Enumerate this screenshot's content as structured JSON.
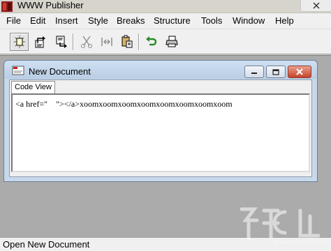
{
  "app": {
    "title": "WWW Publisher"
  },
  "menubar": {
    "items": [
      "File",
      "Edit",
      "Insert",
      "Style",
      "Breaks",
      "Structure",
      "Tools",
      "Window",
      "Help"
    ]
  },
  "toolbar": {
    "buttons": [
      "new-document",
      "open",
      "save",
      "cut",
      "link",
      "paste",
      "undo",
      "print"
    ]
  },
  "document": {
    "title": "New Document",
    "tab_label": "Code View",
    "code": "<a href=\"    \"></a>xoomxoomxoomxoomxoomxoomxoomxoom"
  },
  "statusbar": {
    "text": "Open New Document"
  },
  "watermark": {
    "site": "www.xiazaiba.com"
  },
  "colors": {
    "child_title_gradient_top": "#cfe0f1",
    "close_button": "#c5442c",
    "mdi_background": "#ababab"
  }
}
